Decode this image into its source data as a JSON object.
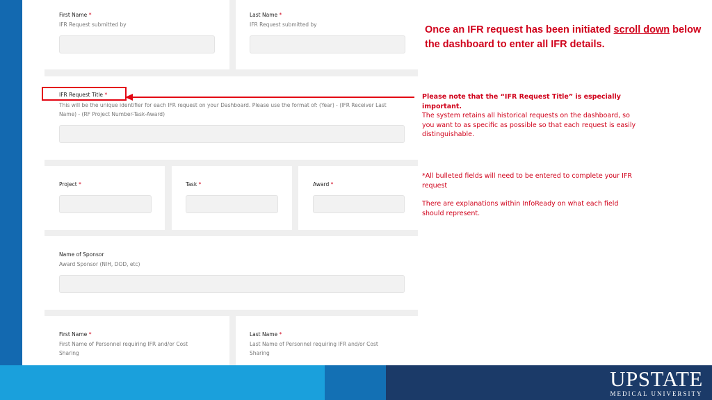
{
  "form": {
    "section1": {
      "first_name_label": "First Name",
      "first_name_hint": "IFR Request submitted by",
      "last_name_label": "Last Name",
      "last_name_hint": "IFR Request submitted by"
    },
    "request_title": {
      "label": "IFR Request Title",
      "hint_line1": "This will be the unique identifier for each IFR request on your Dashboard. Please use the format of: (Year) - (IFR Receiver Last",
      "hint_line2": "Name) - (RF Project Number-Task-Award)"
    },
    "project_label": "Project",
    "task_label": "Task",
    "award_label": "Award",
    "sponsor": {
      "label": "Name of Sponsor",
      "hint": "Award Sponsor (NIH, DOD, etc)"
    },
    "section2": {
      "first_name_label": "First Name",
      "first_name_hint_line1": "First Name of Personnel requiring IFR and/or Cost",
      "first_name_hint_line2": "Sharing",
      "last_name_label": "Last Name",
      "last_name_hint_line1": "Last Name of Personnel requiring IFR and/or Cost",
      "last_name_hint_line2": "Sharing"
    },
    "required_marker": "*"
  },
  "annotations": {
    "headline_part1": "Once an IFR request has been initiated ",
    "headline_link": "scroll down",
    "headline_part2": "below the dashboard to enter all IFR details.",
    "note_bold": "Please note that the “IFR Request Title” is especially important.",
    "note_line2": "The system retains all historical requests on the dashboard, so",
    "note_line3": "you want to as specific as possible so that each request is easily",
    "note_line4": "distinguishable.",
    "bullets_line1": "*All bulleted fields will need to be entered to complete your IFR",
    "bullets_line2": "request",
    "explain_line1": "There are explanations within InfoReady on what each field",
    "explain_line2": "should represent."
  },
  "footer": {
    "logo_main": "UPSTATE",
    "logo_sub": "MEDICAL UNIVERSITY"
  },
  "colors": {
    "accent_red": "#d0021b",
    "left_bar": "#1369b0",
    "footer_light": "#1aa0dc",
    "footer_mid": "#1370b4",
    "footer_dark": "#1b3a68"
  }
}
